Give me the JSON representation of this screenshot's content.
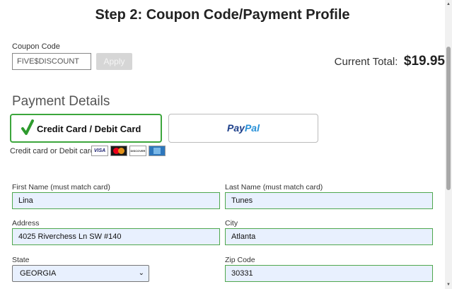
{
  "header": {
    "title": "Step 2: Coupon Code/Payment Profile"
  },
  "coupon": {
    "label": "Coupon Code",
    "value": "FIVE$DISCOUNT",
    "apply_label": "Apply"
  },
  "total": {
    "label": "Current Total:",
    "value": "$19.95"
  },
  "payment": {
    "title": "Payment Details",
    "card_option_label": "Credit Card / Debit Card",
    "paypal_label_pay": "Pay",
    "paypal_label_pal": "Pal",
    "accepted_label": "Credit card or Debit card:",
    "card_logos": [
      "visa-icon",
      "mastercard-icon",
      "discover-icon",
      "amex-icon"
    ],
    "logo_text": {
      "visa": "VISA",
      "discover": "DISCOVER"
    }
  },
  "form": {
    "first_name": {
      "label": "First Name (must match card)",
      "value": "Lina"
    },
    "last_name": {
      "label": "Last Name (must match card)",
      "value": "Tunes"
    },
    "address": {
      "label": "Address",
      "value": "4025 Riverchess Ln SW #140"
    },
    "city": {
      "label": "City",
      "value": "Atlanta"
    },
    "state": {
      "label": "State",
      "value": "GEORGIA"
    },
    "zip": {
      "label": "Zip Code",
      "value": "30331"
    }
  },
  "colors": {
    "selected_border": "#3ca63c",
    "autofill_bg": "#e8f0fe",
    "paypal_dark": "#1d3f8a",
    "paypal_light": "#2790d8"
  }
}
